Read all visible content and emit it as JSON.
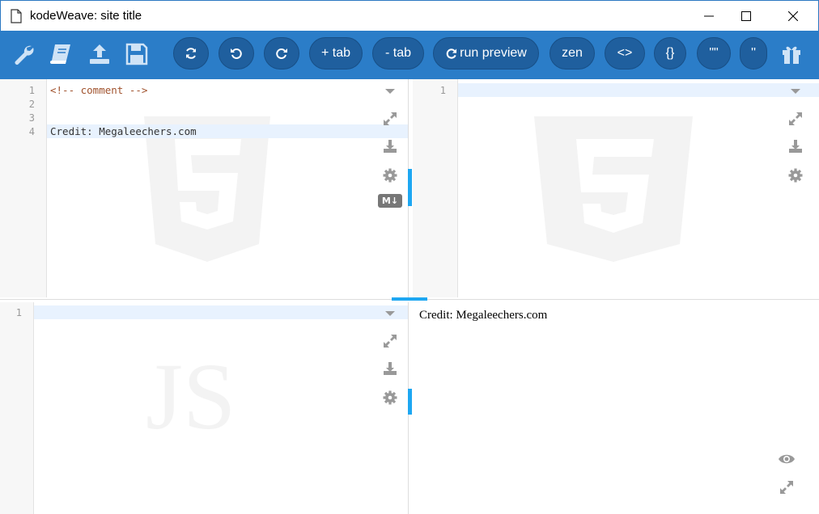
{
  "window": {
    "title": "kodeWeave: site title"
  },
  "toolbar": {
    "icons": [
      "wrench-icon",
      "book-icon",
      "upload-icon",
      "save-icon"
    ],
    "buttons": {
      "refresh_icon": "refresh-icon",
      "undo_icon": "undo-icon",
      "redo_icon": "redo-icon",
      "add_tab": "+ tab",
      "remove_tab": "- tab",
      "run_preview": "run preview",
      "zen": "zen",
      "tags": "<>",
      "braces": "{}",
      "double_quotes": "\"\"",
      "single_quote": "''"
    },
    "gift_icon": "gift-icon"
  },
  "html_pane": {
    "line_numbers": [
      "1",
      "2",
      "3",
      "4"
    ],
    "lines": [
      "<!-- comment -->",
      "",
      "",
      "Credit: Megaleechers.com"
    ],
    "badge": "M↓",
    "watermark": "html5-logo"
  },
  "css_pane": {
    "line_numbers": [
      "1"
    ],
    "watermark": "css3-logo"
  },
  "js_pane": {
    "line_numbers": [
      "1"
    ],
    "watermark": "JS"
  },
  "preview": {
    "text": "Credit: Megaleechers.com"
  },
  "colors": {
    "toolbar": "#2b7dc8",
    "pill": "#1f5f9e",
    "accent": "#1ea7f2",
    "comment": "#a0522d"
  }
}
